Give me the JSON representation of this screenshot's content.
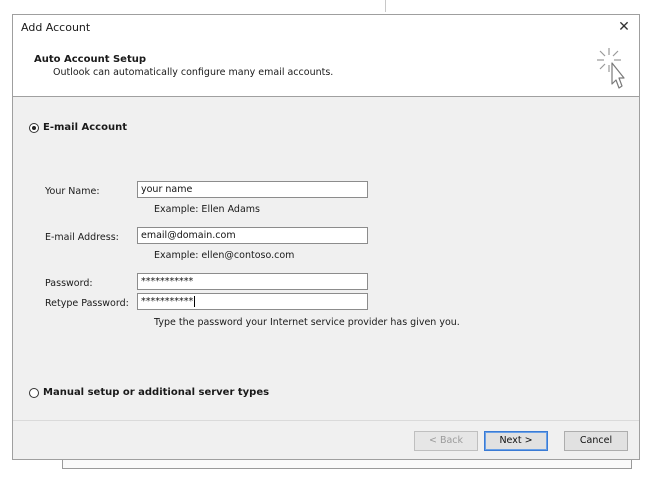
{
  "window": {
    "title": "Add Account",
    "close_glyph": "✕"
  },
  "header": {
    "title": "Auto Account Setup",
    "subtitle": "Outlook can automatically configure many email accounts.",
    "icon": "magic-wand-cursor-icon"
  },
  "email_account": {
    "option_label": "E-mail Account",
    "selected": true,
    "fields": {
      "name": {
        "label": "Your Name:",
        "value": "your name",
        "hint": "Example: Ellen Adams"
      },
      "email": {
        "label": "E-mail Address:",
        "value": "email@domain.com",
        "hint": "Example: ellen@contoso.com"
      },
      "password": {
        "label": "Password:",
        "value": "***********"
      },
      "retype_password": {
        "label": "Retype Password:",
        "value": "***********"
      }
    },
    "password_hint": "Type the password your Internet service provider has given you."
  },
  "manual_setup": {
    "option_label": "Manual setup or additional server types",
    "selected": false
  },
  "buttons": {
    "back": "< Back",
    "next": "Next >",
    "cancel": "Cancel"
  },
  "colors": {
    "panel_bg": "#f0f0f0",
    "accent_border": "#3a7bd5",
    "disabled_text": "#9b9b9b"
  }
}
